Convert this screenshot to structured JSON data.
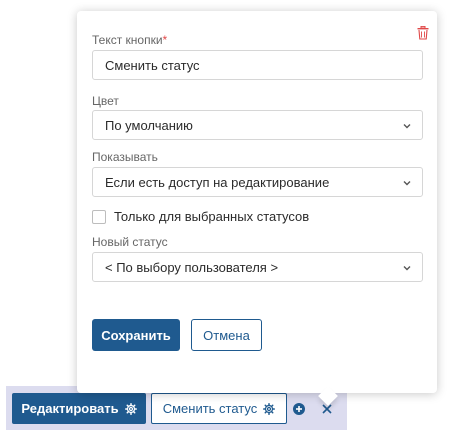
{
  "colors": {
    "primary": "#1f5a8f",
    "danger": "#e04848",
    "toolbar_bg": "#dcdcef"
  },
  "popover": {
    "delete_icon": "trash-icon",
    "button_text": {
      "label": "Текст кнопки",
      "required_mark": "*",
      "value": "Сменить статус"
    },
    "color": {
      "label": "Цвет",
      "selected": "По умолчанию"
    },
    "show": {
      "label": "Показывать",
      "selected": "Если есть доступ на редактирование"
    },
    "only_selected_statuses": {
      "label": "Только для выбранных статусов",
      "checked": false
    },
    "new_status": {
      "label": "Новый статус",
      "selected": "< По выбору пользователя >"
    },
    "save_label": "Сохранить",
    "cancel_label": "Отмена"
  },
  "toolbar": {
    "edit_label": "Редактировать",
    "edit_icon": "gear-icon",
    "change_status_label": "Сменить статус",
    "change_status_icon": "gear-icon",
    "add_icon": "plus-circle-icon",
    "close_icon": "close-icon"
  }
}
